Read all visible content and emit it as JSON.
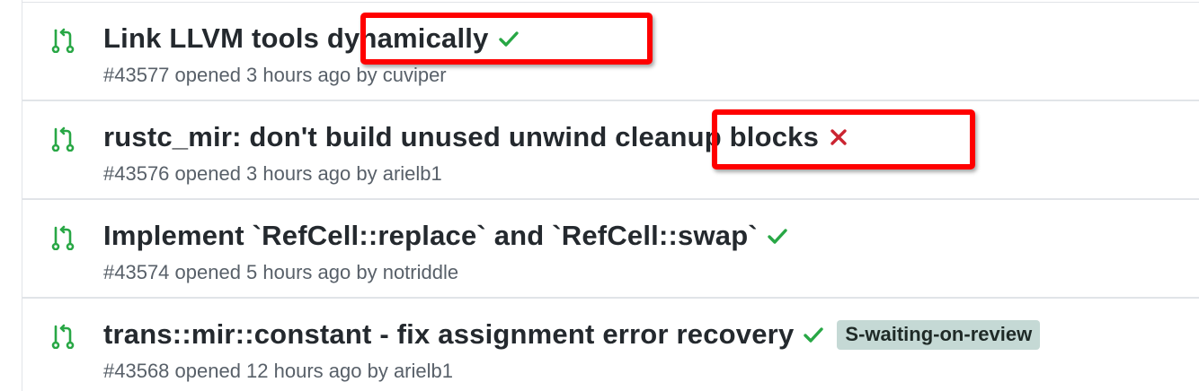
{
  "colors": {
    "open_icon": "#28a745",
    "success": "#28a745",
    "failure": "#cb2431",
    "annotation": "#ff0000",
    "label_bg": "#c5d9d5"
  },
  "pull_requests": [
    {
      "title": "Link LLVM tools dynamically",
      "status": "success",
      "status_icon": "check-icon",
      "meta": "#43577 opened 3 hours ago by cuviper",
      "labels": []
    },
    {
      "title": "rustc_mir: don't build unused unwind cleanup blocks",
      "status": "failure",
      "status_icon": "x-icon",
      "meta": "#43576 opened 3 hours ago by arielb1",
      "labels": []
    },
    {
      "title": "Implement `RefCell::replace` and `RefCell::swap`",
      "status": "success",
      "status_icon": "check-icon",
      "meta": "#43574 opened 5 hours ago by notriddle",
      "labels": []
    },
    {
      "title": "trans::mir::constant - fix assignment error recovery",
      "status": "success",
      "status_icon": "check-icon",
      "meta": "#43568 opened 12 hours ago by arielb1",
      "labels": [
        "S-waiting-on-review"
      ]
    }
  ]
}
